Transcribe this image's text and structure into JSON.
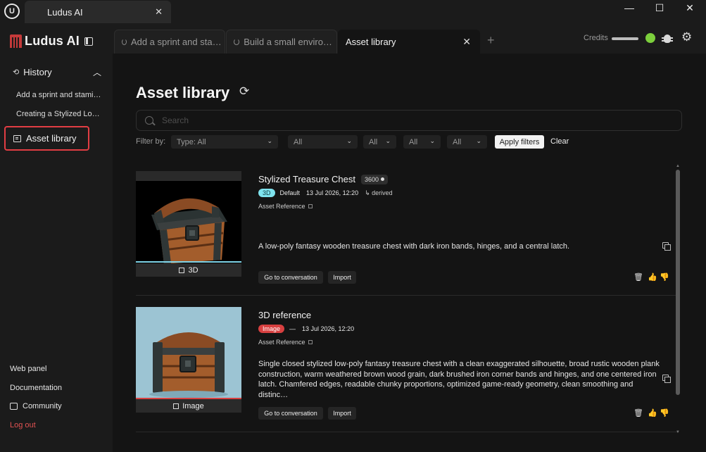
{
  "window": {
    "tab_title": "Ludus AI",
    "close": "✕",
    "minimize": "—",
    "maximize": "☐",
    "close_window": "✕"
  },
  "sidebar": {
    "brand": "Ludus AI",
    "history_label": "History",
    "history_items": [
      "Add a sprint and stamina system",
      "Creating a Stylized Low-Poly Chest"
    ],
    "asset_library_label": "Asset library",
    "links": {
      "web_panel": "Web panel",
      "documentation": "Documentation",
      "community": "Community",
      "logout": "Log out"
    }
  },
  "tabs": [
    {
      "label": "Add a sprint and stamina system",
      "active": false
    },
    {
      "label": "Build a small environment",
      "active": false
    },
    {
      "label": "Asset library",
      "active": true
    }
  ],
  "header": {
    "credits_label": "Credits",
    "status_color": "#7ccf3c"
  },
  "main": {
    "title": "Asset library",
    "search_placeholder": "Search",
    "filter_by": "Filter by:",
    "filters": [
      "Type: All",
      "All",
      "All",
      "All",
      "All"
    ],
    "apply_label": "Apply filters",
    "clear_label": "Clear"
  },
  "assets": [
    {
      "title": "Stylized Treasure Chest",
      "score": "3600",
      "type_badge": "3D",
      "quality": "Default",
      "date": "13 Jul 2026, 12:20",
      "derived": "↳ derived",
      "asset_ref": "Asset Reference",
      "description": "A low-poly fantasy wooden treasure chest with dark iron bands, hinges, and a central latch.",
      "thumb_caption": "3D",
      "go_label": "Go to conversation",
      "import_label": "Import"
    },
    {
      "title": "3D reference",
      "type_badge": "Image",
      "dash": "—",
      "date": "13 Jul 2026, 12:20",
      "asset_ref": "Asset Reference",
      "description": "Single closed stylized low-poly fantasy treasure chest with a clean exaggerated silhouette, broad rustic wooden plank construction, warm weathered brown wood grain, dark brushed iron corner bands and hinges, and one centered iron latch. Chamfered edges, readable chunky proportions, optimized game-ready geometry, clean smoothing and distinc…",
      "thumb_caption": "Image",
      "go_label": "Go to conversation",
      "import_label": "Import"
    }
  ]
}
